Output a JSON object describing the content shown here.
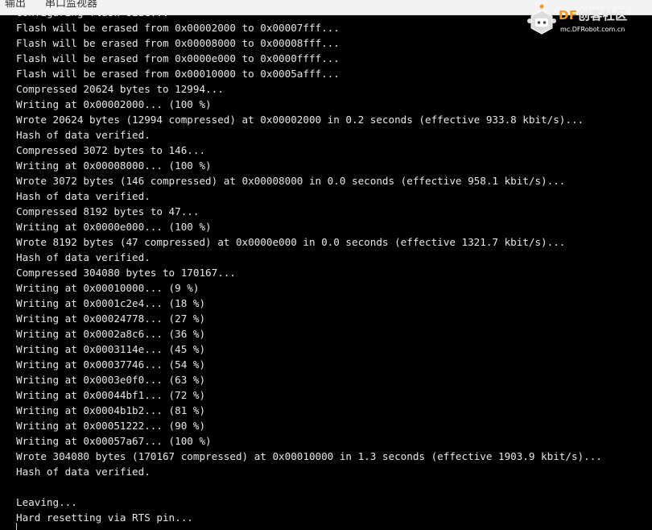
{
  "tabs": [
    {
      "label": "输出"
    },
    {
      "label": "串口监视器"
    }
  ],
  "watermark": {
    "brand_df": "DF",
    "brand_rest": "创客社区",
    "url": "mc.DFRobot.com.cn",
    "accent": "#f39a1e"
  },
  "terminal": {
    "background": "#000000",
    "text_color": "#e8e8e8",
    "lines": [
      "Configuring flash size...",
      "Flash will be erased from 0x00002000 to 0x00007fff...",
      "Flash will be erased from 0x00008000 to 0x00008fff...",
      "Flash will be erased from 0x0000e000 to 0x0000ffff...",
      "Flash will be erased from 0x00010000 to 0x0005afff...",
      "Compressed 20624 bytes to 12994...",
      "Writing at 0x00002000... (100 %)",
      "Wrote 20624 bytes (12994 compressed) at 0x00002000 in 0.2 seconds (effective 933.8 kbit/s)...",
      "Hash of data verified.",
      "Compressed 3072 bytes to 146...",
      "Writing at 0x00008000... (100 %)",
      "Wrote 3072 bytes (146 compressed) at 0x00008000 in 0.0 seconds (effective 958.1 kbit/s)...",
      "Hash of data verified.",
      "Compressed 8192 bytes to 47...",
      "Writing at 0x0000e000... (100 %)",
      "Wrote 8192 bytes (47 compressed) at 0x0000e000 in 0.0 seconds (effective 1321.7 kbit/s)...",
      "Hash of data verified.",
      "Compressed 304080 bytes to 170167...",
      "Writing at 0x00010000... (9 %)",
      "Writing at 0x0001c2e4... (18 %)",
      "Writing at 0x00024778... (27 %)",
      "Writing at 0x0002a8c6... (36 %)",
      "Writing at 0x0003114e... (45 %)",
      "Writing at 0x00037746... (54 %)",
      "Writing at 0x0003e0f0... (63 %)",
      "Writing at 0x00044bf1... (72 %)",
      "Writing at 0x0004b1b2... (81 %)",
      "Writing at 0x00051222... (90 %)",
      "Writing at 0x00057a67... (100 %)",
      "Wrote 304080 bytes (170167 compressed) at 0x00010000 in 1.3 seconds (effective 1903.9 kbit/s)...",
      "Hash of data verified.",
      "",
      "Leaving...",
      "Hard resetting via RTS pin..."
    ]
  }
}
